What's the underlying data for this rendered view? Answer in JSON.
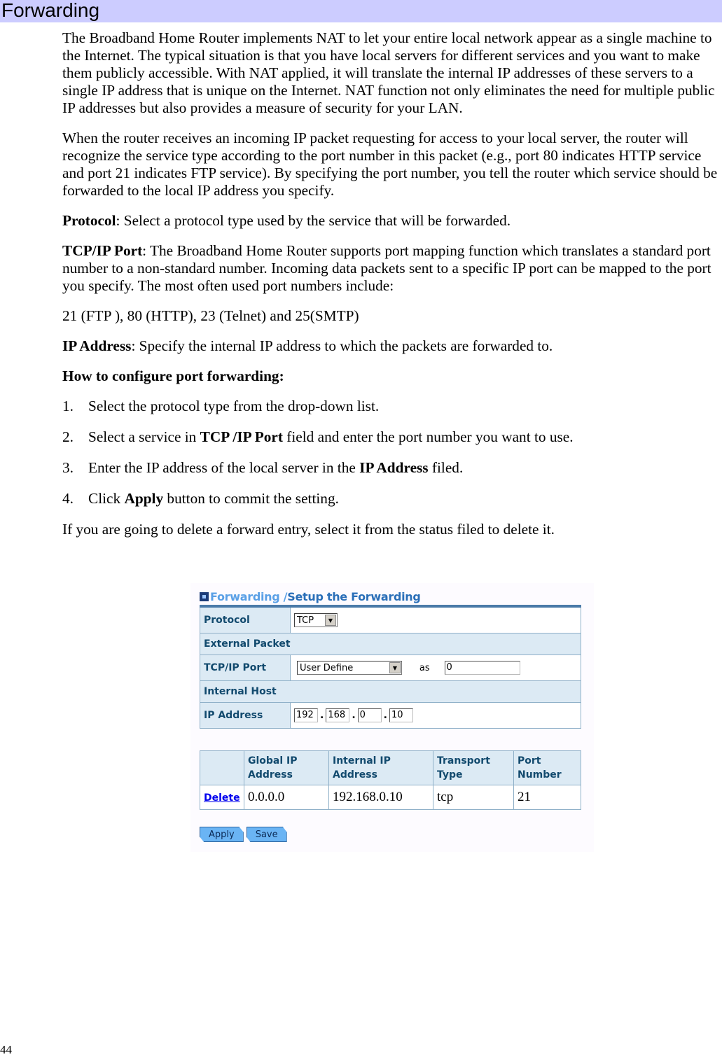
{
  "heading": "Forwarding",
  "paragraphs": {
    "intro": "The Broadband Home Router implements NAT to let your entire local network appear as a single machine to the Internet. The typical situation is that you have local servers for different services and you want to make them publicly accessible. With NAT applied, it will translate the internal IP addresses of these servers to a single IP address that is unique on the Internet. NAT function not only eliminates the need for multiple public IP addresses but also provides a measure of security for your LAN.",
    "packet": "When the router receives an incoming IP packet requesting for access to your local server, the router will recognize the service type according to the port number in this packet (e.g., port 80 indicates HTTP service and port 21 indicates FTP service). By specifying the port number, you tell the router which service should be forwarded to the local IP address you specify.",
    "protocol_term": "Protocol",
    "protocol_desc": ": Select a protocol type used by the service that will be forwarded.",
    "port_term": "TCP/IP Port",
    "port_desc": ": The Broadband Home Router supports port mapping function which translates a standard port number to a non-standard number. Incoming data packets sent to a specific IP port can be mapped to the port you specify. The most often used port numbers include:",
    "ports_list": "21 (FTP ), 80 (HTTP), 23 (Telnet) and 25(SMTP)",
    "ip_term": "IP Address",
    "ip_desc": ": Specify the internal IP address to which the packets are forwarded to.",
    "howto": "How to configure port forwarding:",
    "delete_note": "If you are going to delete a forward entry, select it from the status filed to delete it."
  },
  "steps": [
    {
      "num": "1.",
      "pre": "Select the protocol type from the drop-down list.",
      "bold": "",
      "post": ""
    },
    {
      "num": "2.",
      "pre": "Select a service in ",
      "bold": "TCP /IP Port",
      "post": " field and enter the port number you want to use."
    },
    {
      "num": "3.",
      "pre": "Enter the IP address of the local server in the ",
      "bold": "IP Address",
      "post": " filed."
    },
    {
      "num": "4.",
      "pre": "Click ",
      "bold": "Apply",
      "post": " button to commit the setting."
    }
  ],
  "screenshot": {
    "title_part1": "Forwarding /",
    "title_part2": " Setup the Forwarding",
    "protocol_label": "Protocol",
    "protocol_value": "TCP",
    "external_packet": "External Packet",
    "port_label": "TCP/IP Port",
    "port_service": "User Define",
    "as_label": "as",
    "port_value": "0",
    "internal_host": "Internal Host",
    "ip_label": "IP Address",
    "ip": [
      "192",
      "168",
      "0",
      "10"
    ],
    "ip_sep": ".",
    "table": {
      "headers": [
        "",
        "Global IP Address",
        "Internal IP Address",
        "Transport Type",
        "Port Number"
      ],
      "rows": [
        {
          "action": "Delete",
          "global_ip": "0.0.0.0",
          "internal_ip": "192.168.0.10",
          "transport": "tcp",
          "port": "21"
        }
      ]
    },
    "apply_label": "Apply",
    "save_label": "Save",
    "arrow_glyph": "▼"
  },
  "page_number": "44"
}
